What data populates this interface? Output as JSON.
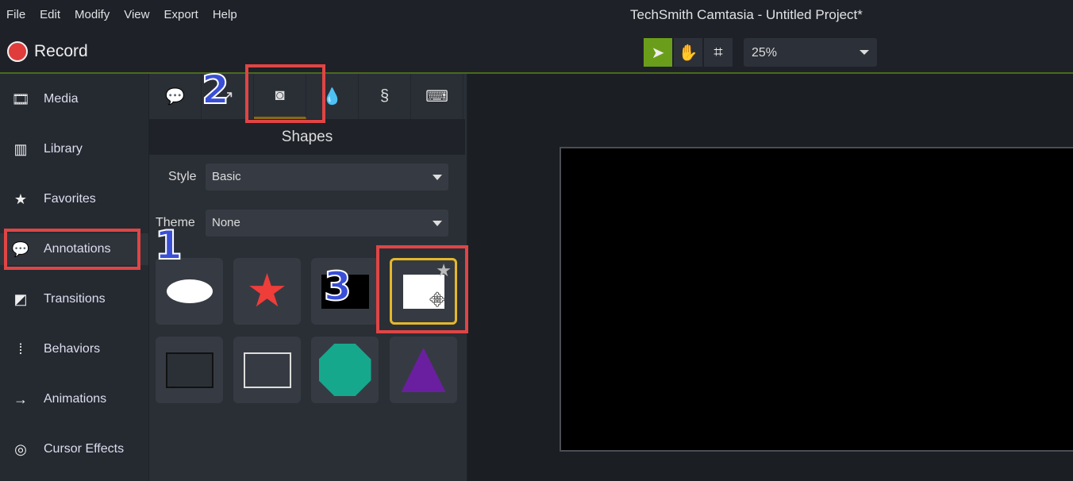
{
  "menu": [
    "File",
    "Edit",
    "Modify",
    "View",
    "Export",
    "Help"
  ],
  "window_title": "TechSmith Camtasia - Untitled Project*",
  "record_label": "Record",
  "tools": {
    "select": "select-arrow-icon",
    "pan": "hand-icon",
    "crop": "crop-icon",
    "active": "select"
  },
  "zoom_level": "25%",
  "sidebar": {
    "items": [
      {
        "label": "Media",
        "icon": "film-icon"
      },
      {
        "label": "Library",
        "icon": "library-icon"
      },
      {
        "label": "Favorites",
        "icon": "star-icon"
      },
      {
        "label": "Annotations",
        "icon": "annotation-icon",
        "active": true
      },
      {
        "label": "Transitions",
        "icon": "transition-icon"
      },
      {
        "label": "Behaviors",
        "icon": "behaviors-icon"
      },
      {
        "label": "Animations",
        "icon": "animation-arrow-icon"
      },
      {
        "label": "Cursor Effects",
        "icon": "cursor-effects-icon"
      }
    ]
  },
  "annotation_tabs": [
    "callouts",
    "arrows-lines",
    "shapes",
    "blur-highlight",
    "sketch-motion",
    "keystroke"
  ],
  "panel": {
    "title": "Shapes",
    "style_label": "Style",
    "style_value": "Basic",
    "theme_label": "Theme",
    "theme_value": "None"
  },
  "shapes": [
    "white-ellipse",
    "red-star",
    "black-rectangle",
    "white-rectangle",
    "dark-rectangle",
    "outlined-rectangle",
    "teal-octagon",
    "purple-triangle"
  ],
  "callouts": {
    "step1": "1",
    "step2": "2",
    "step3": "3"
  },
  "colors": {
    "accent_green": "#6a9e1a",
    "record_red": "#e03c3c",
    "highlight_red": "#e04545",
    "selected_gold": "#e5b82a",
    "step_blue": "#3a4fd6"
  }
}
